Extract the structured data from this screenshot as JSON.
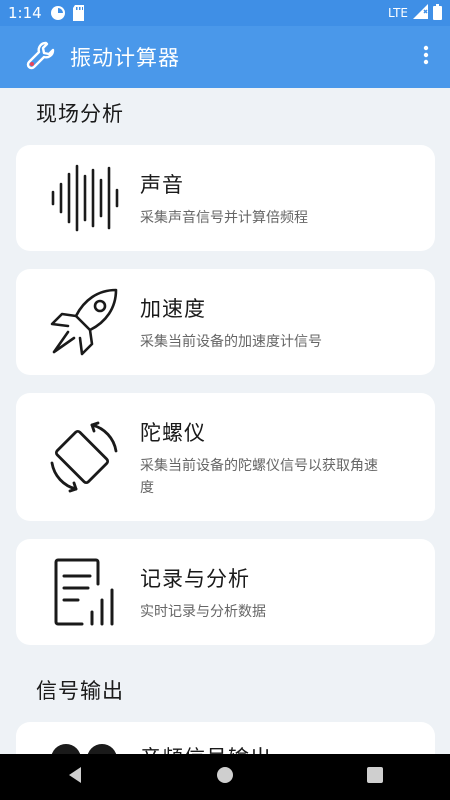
{
  "status": {
    "time": "1:14",
    "network": "LTE"
  },
  "app": {
    "title": "振动计算器",
    "logo_icon": "wrench-icon",
    "menu_icon": "more-vert-icon"
  },
  "sections": {
    "field_analysis": "现场分析",
    "signal_output": "信号输出"
  },
  "cards": [
    {
      "title": "声音",
      "desc": "采集声音信号并计算倍频程",
      "icon": "sound-wave-icon"
    },
    {
      "title": "加速度",
      "desc": "采集当前设备的加速度计信号",
      "icon": "rocket-icon"
    },
    {
      "title": "陀螺仪",
      "desc": "采集当前设备的陀螺仪信号以获取角速度",
      "icon": "screen-rotation-icon"
    },
    {
      "title": "记录与分析",
      "desc": "实时记录与分析数据",
      "icon": "report-chart-icon"
    },
    {
      "title": "音频信号输出",
      "desc": "",
      "icon": "headphones-icon"
    }
  ],
  "colors": {
    "app_bar": "#4a98ea",
    "status_bar": "#3f8fe6",
    "background": "#eef2f6"
  }
}
